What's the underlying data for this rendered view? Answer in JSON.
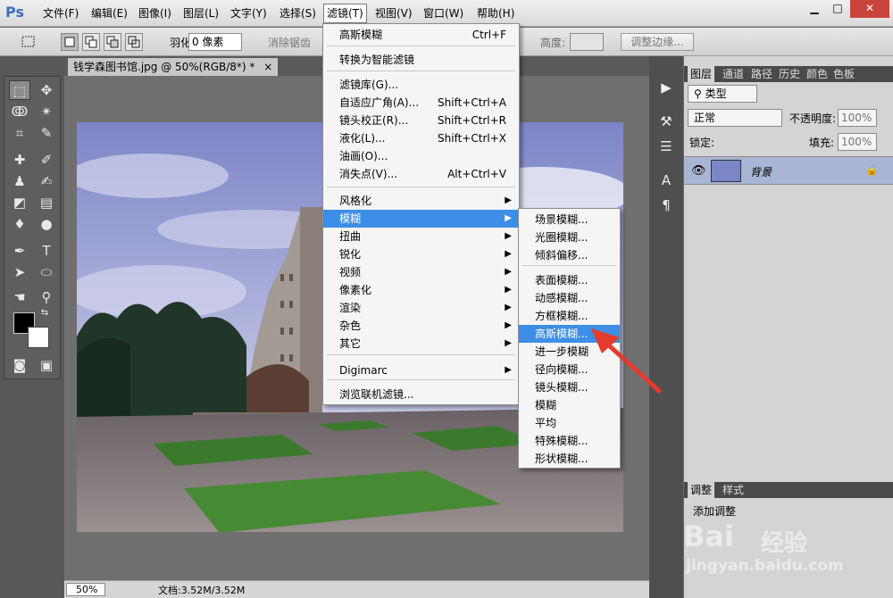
{
  "menubar": {
    "logo": "Ps",
    "items": [
      "文件(F)",
      "编辑(E)",
      "图像(I)",
      "图层(L)",
      "文字(Y)",
      "选择(S)",
      "滤镜(T)",
      "视图(V)",
      "窗口(W)",
      "帮助(H)"
    ],
    "active_index": 6
  },
  "window_controls": {
    "minimize": "▁",
    "restore": "□",
    "close": "✕"
  },
  "options": {
    "feather_label": "羽化:",
    "feather_value": "0 像素",
    "antialias_label": "消除锯齿",
    "height_label": "高度:",
    "refine_edge": "调整边缘..."
  },
  "document_tab": {
    "title": "钱学森图书馆.jpg @ 50%(RGB/8*) *",
    "close": "×"
  },
  "status": {
    "zoom": "50%",
    "doc_info": "文档:3.52M/3.52M"
  },
  "layers_panel": {
    "tabs": [
      "图层",
      "通道",
      "路径",
      "历史",
      "颜色",
      "色板"
    ],
    "filter_label": "类型",
    "blend_mode": "正常",
    "opacity_label": "不透明度:",
    "opacity_value": "100%",
    "lock_label": "锁定:",
    "fill_label": "填充:",
    "fill_value": "100%",
    "layer_name": "背景"
  },
  "adjustments_panel": {
    "tabs": [
      "调整",
      "样式"
    ],
    "add_label": "添加调整"
  },
  "filter_menu": {
    "items": [
      {
        "label": "高斯模糊",
        "shortcut": "Ctrl+F",
        "submenu": false
      },
      {
        "label": "转换为智能滤镜",
        "shortcut": "",
        "submenu": false
      },
      {
        "label": "滤镜库(G)...",
        "shortcut": "",
        "submenu": false
      },
      {
        "label": "自适应广角(A)...",
        "shortcut": "Shift+Ctrl+A",
        "submenu": false
      },
      {
        "label": "镜头校正(R)...",
        "shortcut": "Shift+Ctrl+R",
        "submenu": false
      },
      {
        "label": "液化(L)...",
        "shortcut": "Shift+Ctrl+X",
        "submenu": false
      },
      {
        "label": "油画(O)...",
        "shortcut": "",
        "submenu": false
      },
      {
        "label": "消失点(V)...",
        "shortcut": "Alt+Ctrl+V",
        "submenu": false
      },
      {
        "label": "风格化",
        "shortcut": "",
        "submenu": true
      },
      {
        "label": "模糊",
        "shortcut": "",
        "submenu": true
      },
      {
        "label": "扭曲",
        "shortcut": "",
        "submenu": true
      },
      {
        "label": "锐化",
        "shortcut": "",
        "submenu": true
      },
      {
        "label": "视频",
        "shortcut": "",
        "submenu": true
      },
      {
        "label": "像素化",
        "shortcut": "",
        "submenu": true
      },
      {
        "label": "渲染",
        "shortcut": "",
        "submenu": true
      },
      {
        "label": "杂色",
        "shortcut": "",
        "submenu": true
      },
      {
        "label": "其它",
        "shortcut": "",
        "submenu": true
      },
      {
        "label": "Digimarc",
        "shortcut": "",
        "submenu": true
      },
      {
        "label": "浏览联机滤镜...",
        "shortcut": "",
        "submenu": false
      }
    ],
    "highlighted_index": 9
  },
  "blur_submenu": {
    "items": [
      "场景模糊...",
      "光圈模糊...",
      "倾斜偏移...",
      "表面模糊...",
      "动感模糊...",
      "方框模糊...",
      "高斯模糊...",
      "进一步模糊",
      "径向模糊...",
      "镜头模糊...",
      "模糊",
      "平均",
      "特殊模糊...",
      "形状模糊..."
    ],
    "highlighted_index": 6
  },
  "watermark": {
    "brand": "Bai",
    "brand2": "经验",
    "url": "jingyan.baidu.com"
  },
  "colors": {
    "highlight": "#3d8ee6",
    "arrow": "#e33b2e",
    "layer_selected": "#a9b6d3"
  }
}
